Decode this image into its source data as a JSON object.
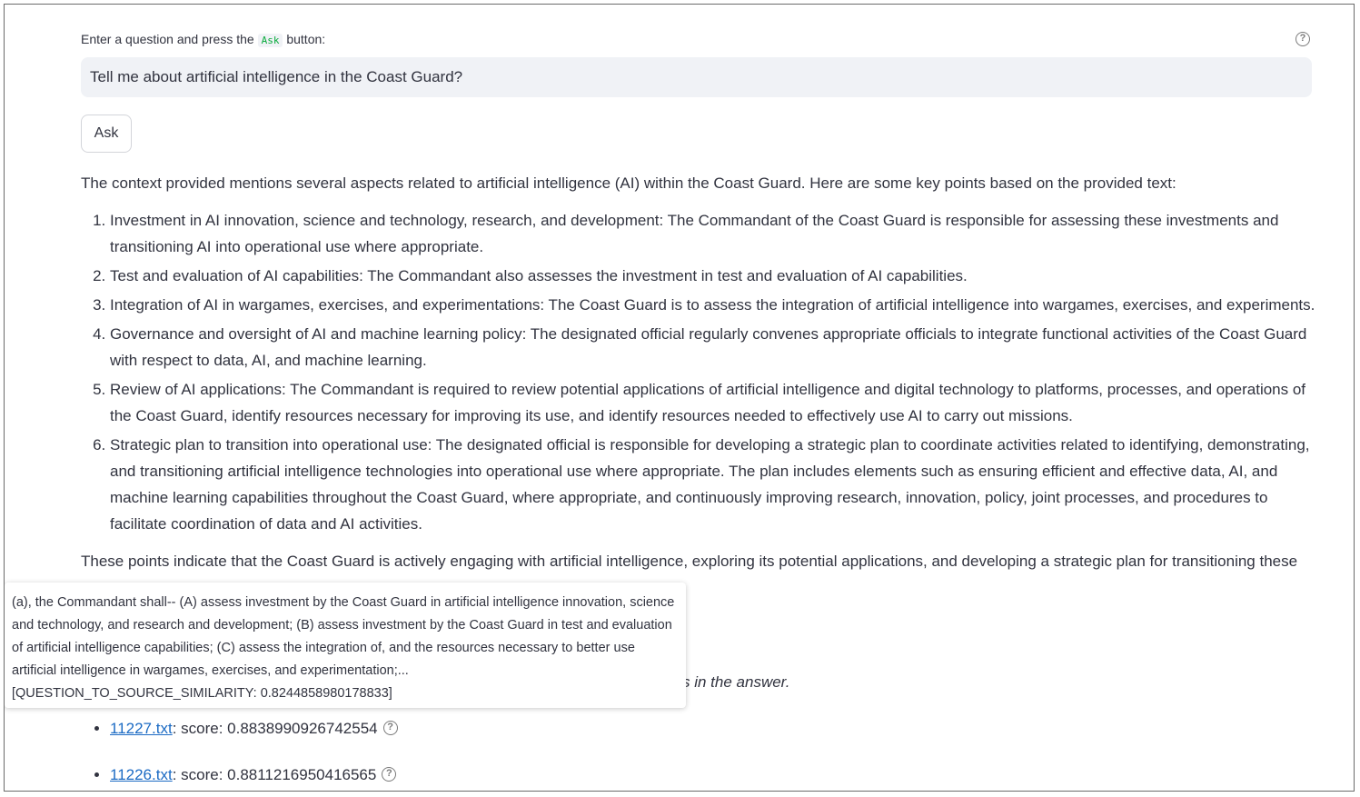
{
  "question": {
    "label_prefix": "Enter a question and press the",
    "label_code": "Ask",
    "label_suffix": "button:",
    "value": "Tell me about artificial intelligence in the Coast Guard?",
    "help_icon": "question-circle-icon"
  },
  "ask_button": {
    "label": "Ask"
  },
  "answer": {
    "intro": "The context provided mentions several aspects related to artificial intelligence (AI) within the Coast Guard. Here are some key points based on the provided text:",
    "points": [
      "Investment in AI innovation, science and technology, research, and development: The Commandant of the Coast Guard is responsible for assessing these investments and transitioning AI into operational use where appropriate.",
      "Test and evaluation of AI capabilities: The Commandant also assesses the investment in test and evaluation of AI capabilities.",
      "Integration of AI in wargames, exercises, and experimentations: The Coast Guard is to assess the integration of artificial intelligence into wargames, exercises, and experiments.",
      "Governance and oversight of AI and machine learning policy: The designated official regularly convenes appropriate officials to integrate functional activities of the Coast Guard with respect to data, AI, and machine learning.",
      "Review of AI applications: The Commandant is required to review potential applications of artificial intelligence and digital technology to platforms, processes, and operations of the Coast Guard, identify resources necessary for improving its use, and identify resources needed to effectively use AI to carry out missions.",
      "Strategic plan to transition into operational use: The designated official is responsible for developing a strategic plan to coordinate activities related to identifying, demonstrating, and transitioning artificial intelligence technologies into operational use where appropriate. The plan includes elements such as ensuring efficient and effective data, AI, and machine learning capabilities throughout the Coast Guard, where appropriate, and continuously improving research, innovation, policy, joint processes, and procedures to facilitate coordination of data and AI activities."
    ],
    "conclusion": "These points indicate that the Coast Guard is actively engaging with artificial intelligence, exploring its potential applications, and developing a strategic plan for transitioning these"
  },
  "italic_note_visible": "s in the answer.",
  "sources": [
    {
      "file": "11227.txt",
      "score_text": ": score: 0.8838990926742554"
    },
    {
      "file": "11226.txt",
      "score_text": ": score: 0.8811216950416565"
    }
  ],
  "tooltip": {
    "text": "(a), the Commandant shall-- (A) assess investment by the Coast Guard in artificial intelligence innovation, science and technology, and research and development; (B) assess investment by the Coast Guard in test and evaluation of artificial intelligence capabilities; (C) assess the integration of, and the resources necessary to better use artificial intelligence in wargames, exercises, and experimentation;...",
    "similarity": "[QUESTION_TO_SOURCE_SIMILARITY: 0.8244858980178833]"
  }
}
